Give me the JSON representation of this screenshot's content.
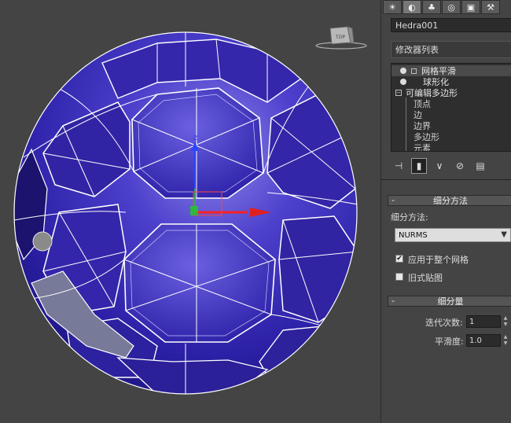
{
  "object_name": "Hedra001",
  "modifier_list_label": "修改器列表",
  "modifier_stack": [
    {
      "label": "网格平滑",
      "type": "modifier",
      "selected": true
    },
    {
      "label": "球形化",
      "type": "modifier",
      "selected": false
    },
    {
      "label": "可编辑多边形",
      "type": "base",
      "selected": false
    },
    {
      "label": "顶点",
      "type": "sub"
    },
    {
      "label": "边",
      "type": "sub"
    },
    {
      "label": "边界",
      "type": "sub"
    },
    {
      "label": "多边形",
      "type": "sub"
    },
    {
      "label": "元素",
      "type": "sub"
    }
  ],
  "panel_tabs": [
    "create-icon",
    "modify-icon",
    "hierarchy-icon",
    "motion-icon",
    "display-icon",
    "utilities-icon"
  ],
  "stack_tools": [
    "pin-stack-icon",
    "show-end-result-icon",
    "make-unique-icon",
    "remove-modifier-icon",
    "configure-sets-icon"
  ],
  "subdivision_method": {
    "rollout_title": "细分方法",
    "field_label": "细分方法:",
    "selected": "NURMS",
    "apply_whole_mesh": {
      "label": "应用于整个网格",
      "checked": true
    },
    "old_style_mapping": {
      "label": "旧式贴图",
      "checked": false
    }
  },
  "subdivision_amount": {
    "rollout_title": "细分量",
    "iterations": {
      "label": "迭代次数:",
      "value": "1"
    },
    "smoothness": {
      "label": "平滑度:",
      "value": "1.0"
    }
  },
  "colors": {
    "ball_fill": "#3a2fb0",
    "wireframe": "#ffffff",
    "viewport_bg": "#444444",
    "panel_bg": "#444444",
    "gizmo_x": "#e02020",
    "gizmo_y": "#20c020",
    "gizmo_z": "#2040ff"
  }
}
